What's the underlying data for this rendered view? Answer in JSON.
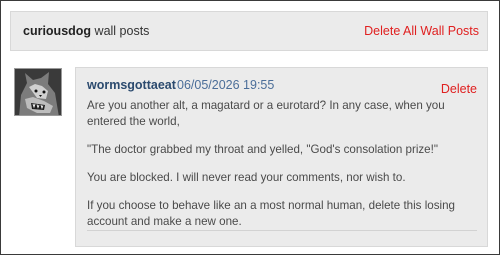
{
  "header": {
    "username": "curiousdog",
    "title_suffix": "wall posts",
    "delete_all_label": "Delete All Wall Posts"
  },
  "post": {
    "avatar_icon": "wolf-avatar",
    "author": "wormsgottaeat",
    "timestamp": "06/05/2026 19:55",
    "delete_label": "Delete",
    "paragraphs": [
      "Are you another alt, a magatard or a eurotard? In any case, when you entered the world,",
      "\"The doctor grabbed my throat and yelled, \"God's consolation prize!\"",
      "You are blocked. I will never read your comments, nor wish to.",
      "If you choose to behave like an a most normal human, delete this losing account and make a new one."
    ]
  },
  "colors": {
    "delete_red": "#e02020",
    "author_blue": "#2b4a6e",
    "timestamp_blue": "#4b6e99",
    "panel_gray": "#ebebeb"
  }
}
